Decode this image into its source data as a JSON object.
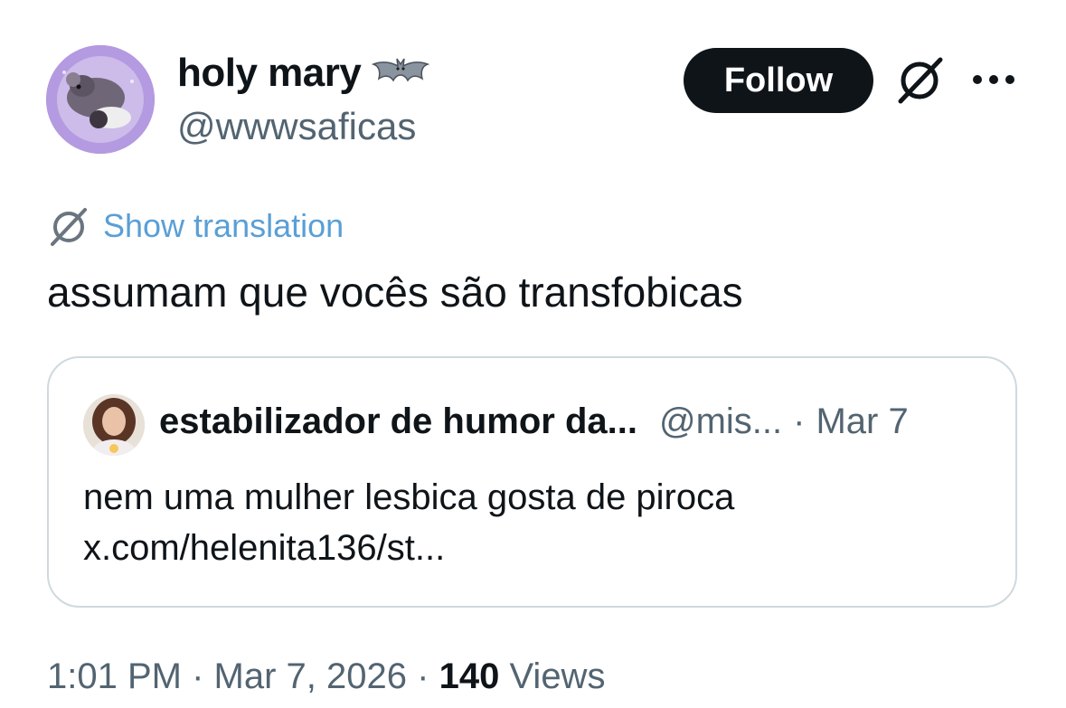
{
  "author": {
    "display_name": "holy mary",
    "handle": "@wwwsaficas",
    "name_emoji": "bat-icon",
    "avatar": "rat-avatar"
  },
  "actions": {
    "follow_label": "Follow",
    "grok_icon": "grok-icon",
    "more_icon": "more-options-icon"
  },
  "translation": {
    "label": "Show translation",
    "icon": "grok-icon"
  },
  "tweet": {
    "text": "assumam que vocês são transfobicas"
  },
  "quote": {
    "display_name": "estabilizador de humor da...",
    "handle": "@mis...",
    "separator": "·",
    "date": "Mar 7",
    "line1": "nem uma mulher lesbica gosta de piroca",
    "line2": "x.com/helenita136/st..."
  },
  "footer": {
    "time": "1:01 PM",
    "sep1": "·",
    "date": "Mar 7, 2026",
    "sep2": "·",
    "views_count": "140",
    "views_label": "Views"
  },
  "colors": {
    "text_primary": "#0f1419",
    "text_secondary": "#536471",
    "link": "#5a9fd6",
    "follow_bg": "#0f1419",
    "border": "#cfd9de"
  }
}
